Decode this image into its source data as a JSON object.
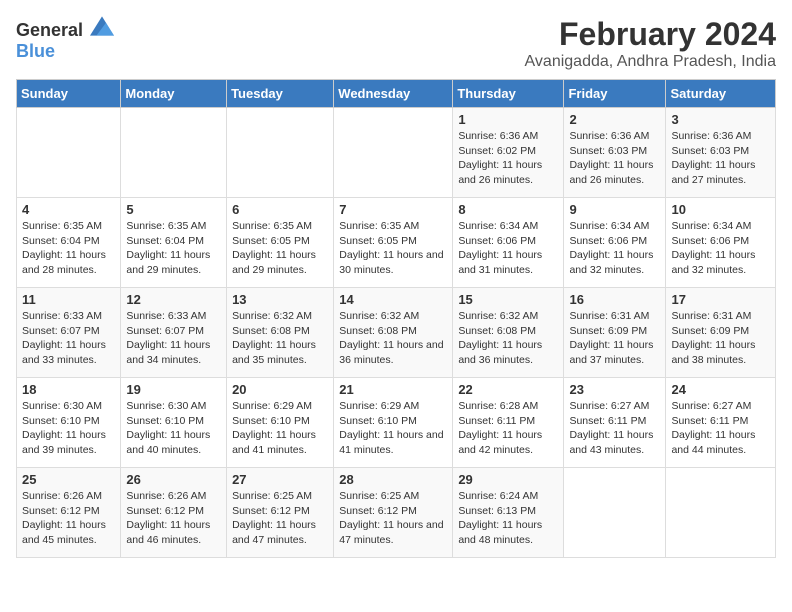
{
  "logo": {
    "general": "General",
    "blue": "Blue"
  },
  "title": "February 2024",
  "subtitle": "Avanigadda, Andhra Pradesh, India",
  "days_of_week": [
    "Sunday",
    "Monday",
    "Tuesday",
    "Wednesday",
    "Thursday",
    "Friday",
    "Saturday"
  ],
  "weeks": [
    [
      {
        "day": "",
        "info": ""
      },
      {
        "day": "",
        "info": ""
      },
      {
        "day": "",
        "info": ""
      },
      {
        "day": "",
        "info": ""
      },
      {
        "day": "1",
        "info": "Sunrise: 6:36 AM\nSunset: 6:02 PM\nDaylight: 11 hours and 26 minutes."
      },
      {
        "day": "2",
        "info": "Sunrise: 6:36 AM\nSunset: 6:03 PM\nDaylight: 11 hours and 26 minutes."
      },
      {
        "day": "3",
        "info": "Sunrise: 6:36 AM\nSunset: 6:03 PM\nDaylight: 11 hours and 27 minutes."
      }
    ],
    [
      {
        "day": "4",
        "info": "Sunrise: 6:35 AM\nSunset: 6:04 PM\nDaylight: 11 hours and 28 minutes."
      },
      {
        "day": "5",
        "info": "Sunrise: 6:35 AM\nSunset: 6:04 PM\nDaylight: 11 hours and 29 minutes."
      },
      {
        "day": "6",
        "info": "Sunrise: 6:35 AM\nSunset: 6:05 PM\nDaylight: 11 hours and 29 minutes."
      },
      {
        "day": "7",
        "info": "Sunrise: 6:35 AM\nSunset: 6:05 PM\nDaylight: 11 hours and 30 minutes."
      },
      {
        "day": "8",
        "info": "Sunrise: 6:34 AM\nSunset: 6:06 PM\nDaylight: 11 hours and 31 minutes."
      },
      {
        "day": "9",
        "info": "Sunrise: 6:34 AM\nSunset: 6:06 PM\nDaylight: 11 hours and 32 minutes."
      },
      {
        "day": "10",
        "info": "Sunrise: 6:34 AM\nSunset: 6:06 PM\nDaylight: 11 hours and 32 minutes."
      }
    ],
    [
      {
        "day": "11",
        "info": "Sunrise: 6:33 AM\nSunset: 6:07 PM\nDaylight: 11 hours and 33 minutes."
      },
      {
        "day": "12",
        "info": "Sunrise: 6:33 AM\nSunset: 6:07 PM\nDaylight: 11 hours and 34 minutes."
      },
      {
        "day": "13",
        "info": "Sunrise: 6:32 AM\nSunset: 6:08 PM\nDaylight: 11 hours and 35 minutes."
      },
      {
        "day": "14",
        "info": "Sunrise: 6:32 AM\nSunset: 6:08 PM\nDaylight: 11 hours and 36 minutes."
      },
      {
        "day": "15",
        "info": "Sunrise: 6:32 AM\nSunset: 6:08 PM\nDaylight: 11 hours and 36 minutes."
      },
      {
        "day": "16",
        "info": "Sunrise: 6:31 AM\nSunset: 6:09 PM\nDaylight: 11 hours and 37 minutes."
      },
      {
        "day": "17",
        "info": "Sunrise: 6:31 AM\nSunset: 6:09 PM\nDaylight: 11 hours and 38 minutes."
      }
    ],
    [
      {
        "day": "18",
        "info": "Sunrise: 6:30 AM\nSunset: 6:10 PM\nDaylight: 11 hours and 39 minutes."
      },
      {
        "day": "19",
        "info": "Sunrise: 6:30 AM\nSunset: 6:10 PM\nDaylight: 11 hours and 40 minutes."
      },
      {
        "day": "20",
        "info": "Sunrise: 6:29 AM\nSunset: 6:10 PM\nDaylight: 11 hours and 41 minutes."
      },
      {
        "day": "21",
        "info": "Sunrise: 6:29 AM\nSunset: 6:10 PM\nDaylight: 11 hours and 41 minutes."
      },
      {
        "day": "22",
        "info": "Sunrise: 6:28 AM\nSunset: 6:11 PM\nDaylight: 11 hours and 42 minutes."
      },
      {
        "day": "23",
        "info": "Sunrise: 6:27 AM\nSunset: 6:11 PM\nDaylight: 11 hours and 43 minutes."
      },
      {
        "day": "24",
        "info": "Sunrise: 6:27 AM\nSunset: 6:11 PM\nDaylight: 11 hours and 44 minutes."
      }
    ],
    [
      {
        "day": "25",
        "info": "Sunrise: 6:26 AM\nSunset: 6:12 PM\nDaylight: 11 hours and 45 minutes."
      },
      {
        "day": "26",
        "info": "Sunrise: 6:26 AM\nSunset: 6:12 PM\nDaylight: 11 hours and 46 minutes."
      },
      {
        "day": "27",
        "info": "Sunrise: 6:25 AM\nSunset: 6:12 PM\nDaylight: 11 hours and 47 minutes."
      },
      {
        "day": "28",
        "info": "Sunrise: 6:25 AM\nSunset: 6:12 PM\nDaylight: 11 hours and 47 minutes."
      },
      {
        "day": "29",
        "info": "Sunrise: 6:24 AM\nSunset: 6:13 PM\nDaylight: 11 hours and 48 minutes."
      },
      {
        "day": "",
        "info": ""
      },
      {
        "day": "",
        "info": ""
      }
    ]
  ]
}
